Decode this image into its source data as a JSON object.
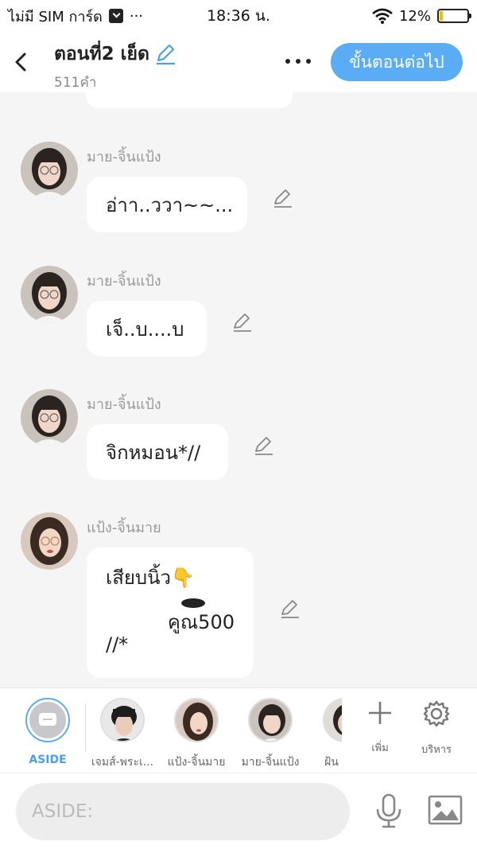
{
  "status_bar": {
    "carrier": "ไม่มี SIM การ์ด",
    "dots": "···",
    "time": "18:36 น.",
    "battery": "12%"
  },
  "header": {
    "title": "ตอนที่2 เย็ด",
    "word_count": "511คำ",
    "next_button": "ขั้นตอนต่อไป"
  },
  "messages": [
    {
      "sender": "มาย-จิ้นแป้ง",
      "text": "อ่าา..ววา~~..."
    },
    {
      "sender": "มาย-จิ้นแป้ง",
      "text": "เจ็..บ....บ"
    },
    {
      "sender": "มาย-จิ้นแป้ง",
      "text": "จิกหมอน*//"
    },
    {
      "sender": "แป้ง-จิ้นมาย",
      "line1": "เสียบนิ้ว👇",
      "line2": "คูณ500",
      "line3": "//*"
    }
  ],
  "character_bar": {
    "aside_label": "ASIDE",
    "characters": [
      "เจมส์-พระเ...",
      "แป้ง-จิ้นมาย",
      "มาย-จิ้นแป้ง",
      "ฝ้น"
    ],
    "add_label": "เพิ่ม",
    "manage_label": "บริหาร"
  },
  "input": {
    "placeholder": "ASIDE:"
  },
  "colors": {
    "accent": "#5aacf5",
    "aside_label": "#4a9ff0",
    "background": "#f5f5f5"
  }
}
